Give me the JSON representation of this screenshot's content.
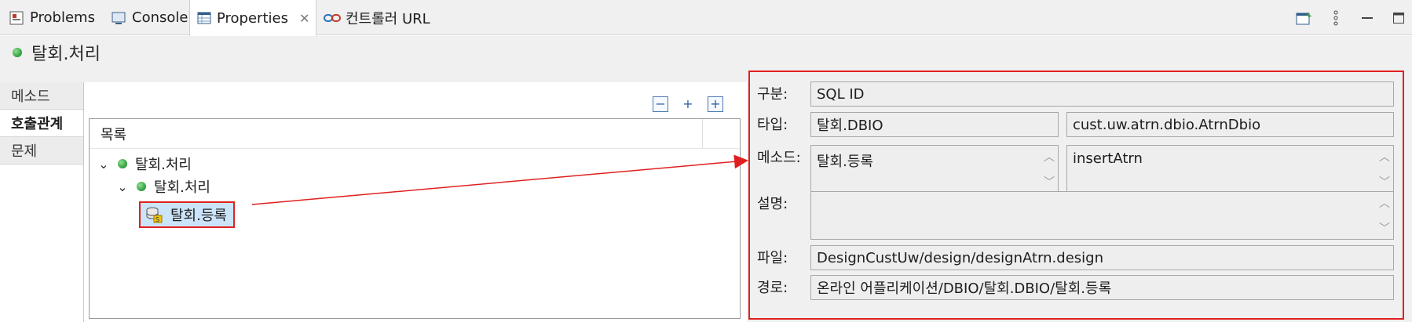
{
  "tabs": [
    {
      "label": "Problems",
      "icon": "problems-icon"
    },
    {
      "label": "Console",
      "icon": "console-icon"
    },
    {
      "label": "Properties",
      "icon": "properties-icon",
      "active": true
    },
    {
      "label": "컨트롤러 URL",
      "icon": "link-icon"
    }
  ],
  "title": "탈회.처리",
  "side_tabs": [
    "메소드",
    "호출관계",
    "문제"
  ],
  "tree": {
    "header": "목록",
    "nodes": {
      "root": "탈회.처리",
      "child": "탈회.처리",
      "leaf": "탈회.등록"
    }
  },
  "details": {
    "labels": {
      "type": "구분:",
      "kind": "타입:",
      "method": "메소드:",
      "desc": "설명:",
      "file": "파일:",
      "path": "경로:"
    },
    "type_value": "SQL ID",
    "kind_value_1": "탈회.DBIO",
    "kind_value_2": "cust.uw.atrn.dbio.AtrnDbio",
    "method_value_1": "탈회.등록",
    "method_value_2": "insertAtrn",
    "desc_value": "",
    "file_value": "DesignCustUw/design/designAtrn.design",
    "path_value": "온라인 어플리케이션/DBIO/탈회.DBIO/탈회.등록"
  },
  "colors": {
    "highlight": "#e02020",
    "selection": "#cce4fa",
    "node_dot": "#2e9a3a"
  }
}
